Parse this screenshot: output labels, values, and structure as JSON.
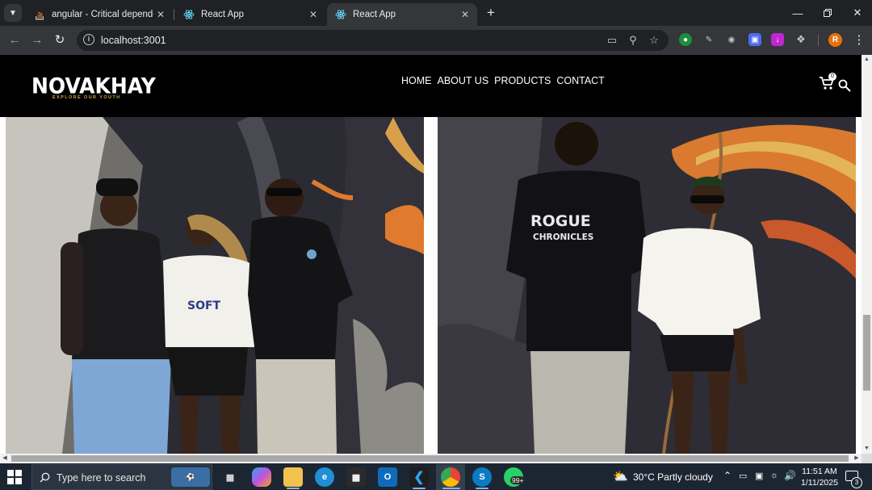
{
  "browser": {
    "tabs": [
      {
        "title": "angular - Critical dependency: r",
        "active": false,
        "favicon": "stackoverflow-icon"
      },
      {
        "title": "React App",
        "active": false,
        "favicon": "react-icon"
      },
      {
        "title": "React App",
        "active": true,
        "favicon": "react-icon"
      }
    ],
    "url": "localhost:3001",
    "profile_initial": "R"
  },
  "site": {
    "logo": "NOVAKHAY",
    "tagline": "EXPLORE OUR YOUTH",
    "nav": [
      "HOME",
      "ABOUT US",
      "PRODUCTS",
      "CONTACT"
    ],
    "cart_count": "0",
    "photos": [
      {
        "alt": "Three models posing against graffiti wall",
        "graphic_text": "SOFT"
      },
      {
        "alt": "Two models posing, one showing back of shirt",
        "graphic_text": "ROGUE CHRONICLES"
      }
    ]
  },
  "taskbar": {
    "search_placeholder": "Type here to search",
    "weather": "30°C  Partly cloudy",
    "time": "11:51 AM",
    "date": "1/11/2025",
    "notification_count": "3",
    "whatsapp_badge": "99+"
  },
  "colors": {
    "header": "#000000",
    "tagline": "#c9a24a",
    "taskbar": "#1c2633"
  }
}
